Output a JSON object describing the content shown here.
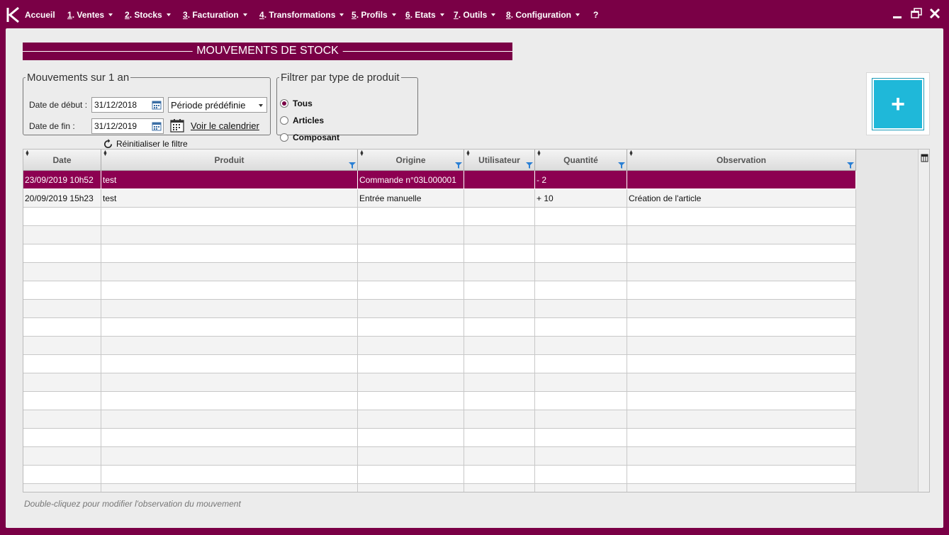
{
  "menubar": {
    "items": [
      {
        "num": "",
        "label": "Accueil",
        "caret": false
      },
      {
        "num": "1",
        "label": ". Ventes",
        "caret": true
      },
      {
        "num": "2",
        "label": ". Stocks",
        "caret": true
      },
      {
        "num": "3",
        "label": ". Facturation",
        "caret": true
      },
      {
        "num": "4",
        "label": ". Transformations",
        "caret": true
      },
      {
        "num": "5",
        "label": ". Profils",
        "caret": true
      },
      {
        "num": "6",
        "label": ". Etats",
        "caret": true
      },
      {
        "num": "7",
        "label": ". Outils",
        "caret": true
      },
      {
        "num": "8",
        "label": ". Configuration",
        "caret": true
      },
      {
        "num": "",
        "label": "?",
        "caret": false
      }
    ]
  },
  "page": {
    "title": "MOUVEMENTS DE STOCK"
  },
  "period": {
    "legend": "Mouvements sur 1 an",
    "start_label": "Date de début :",
    "start_value": "31/12/2018",
    "end_label": "Date de fin :",
    "end_value": "31/12/2019",
    "preset_value": "Période prédéfinie",
    "calendar_link": "Voir le calendrier",
    "reset_label": "Réinitialiser le filtre"
  },
  "type_filter": {
    "legend": "Filtrer par type de produit",
    "options": [
      "Tous",
      "Articles",
      "Composant"
    ],
    "selected": "Tous"
  },
  "add_button": {
    "label": "+"
  },
  "table": {
    "columns": [
      "Date",
      "Produit",
      "Origine",
      "Utilisateur",
      "Quantité",
      "Observation"
    ],
    "rows": [
      [
        "23/09/2019 10h52",
        "test",
        "Commande n°03L000001",
        "",
        "- 2",
        ""
      ],
      [
        "20/09/2019 15h23",
        "test",
        "Entrée manuelle",
        "",
        "+ 10",
        "Création de l'article"
      ]
    ],
    "selected_row": 0
  },
  "footer": {
    "hint": "Double-cliquez pour modifier l'observation du mouvement"
  },
  "colors": {
    "brand": "#7a0046",
    "accent": "#1fb8d9",
    "selection": "#8c0051"
  },
  "icons": {
    "logo": "k-logo-icon",
    "minimize": "minimize-icon",
    "restore": "restore-icon",
    "close": "close-icon",
    "date_picker": "calendar-icon",
    "calendar_link": "calendar-grid-icon",
    "reset": "refresh-icon",
    "filter": "filter-funnel-icon",
    "column_settings": "column-settings-icon"
  }
}
